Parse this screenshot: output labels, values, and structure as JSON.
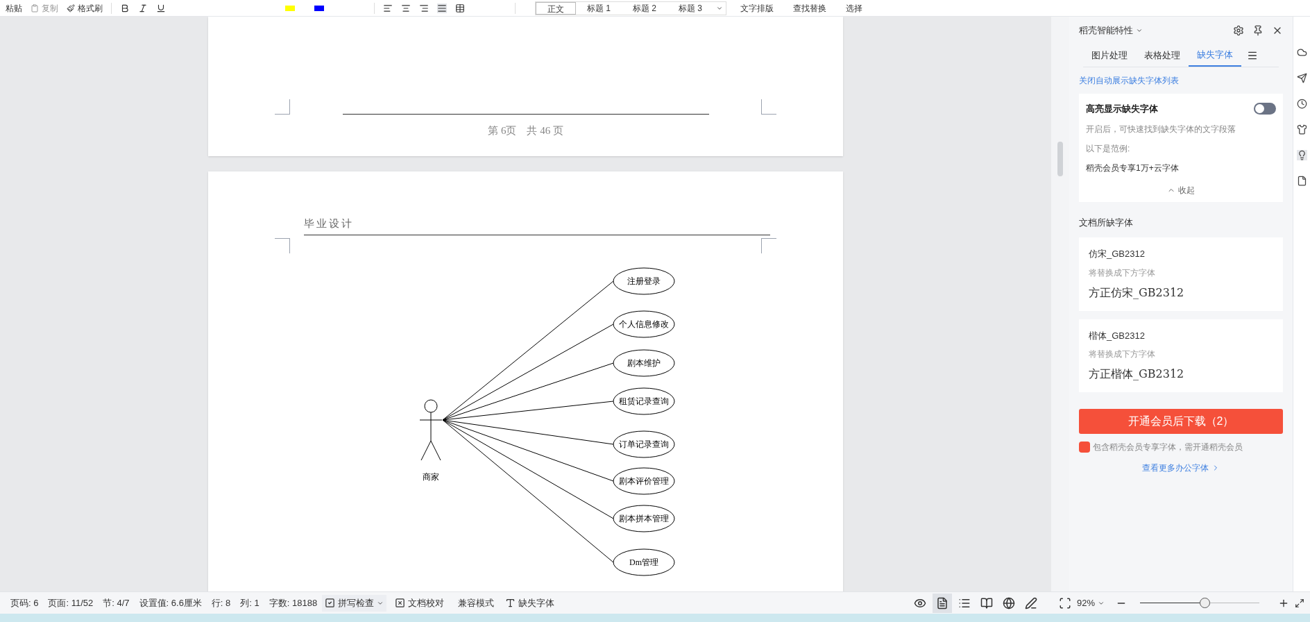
{
  "toolbar": {
    "clipboard": [
      "粘贴",
      "复制",
      "格式刷"
    ],
    "styles": [
      {
        "label": "正文",
        "selected": true
      },
      {
        "label": "标题 1",
        "selected": false
      },
      {
        "label": "标题 2",
        "selected": false
      },
      {
        "label": "标题 3",
        "selected": false
      }
    ],
    "tools": [
      "文字排版",
      "查找替换",
      "选择"
    ]
  },
  "document": {
    "previous_page_footer": "第 6页　共 46 页",
    "header": "毕业设计",
    "diagram": {
      "actor": "商家",
      "use_cases": [
        "注册登录",
        "个人信息修改",
        "剧本维护",
        "租赁记录查询",
        "订单记录查询",
        "剧本评价管理",
        "剧本拼本管理",
        "Dm管理"
      ]
    }
  },
  "panel": {
    "title": "稻壳智能特性",
    "tabs": [
      {
        "label": "图片处理",
        "selected": false
      },
      {
        "label": "表格处理",
        "selected": false
      },
      {
        "label": "缺失字体",
        "selected": true
      }
    ],
    "link": "关闭自动展示缺失字体列表",
    "highlight": {
      "title": "高亮显示缺失字体",
      "on": false,
      "description": "开启后，可快速找到缺失字体的文字段落",
      "example_label": "以下是范例:",
      "example": "稻壳会员专享1万+云字体",
      "collapse": "收起"
    },
    "section_title": "文档所缺字体",
    "fonts": [
      {
        "name": "仿宋_GB2312",
        "hint": "将替换成下方字体",
        "replacement": "方正仿宋_GB2312"
      },
      {
        "name": "楷体_GB2312",
        "hint": "将替换成下方字体",
        "replacement": "方正楷体_GB2312"
      }
    ],
    "button": "开通会员后下载（2）",
    "note": "包含稻壳会员专享字体，需开通稻壳会员",
    "more_link": "查看更多办公字体"
  },
  "status_bar": {
    "items": [
      "页码: 6",
      "页面: 11/52",
      "节: 4/7",
      "设置值: 6.6厘米",
      "行: 8",
      "列: 1",
      "字数: 18188"
    ],
    "spell_check": "拼写检查",
    "proofread": "文档校对",
    "compat": "兼容模式",
    "missing_fonts": "缺失字体",
    "views": [
      {
        "kind": "eye",
        "selected": false
      },
      {
        "kind": "page",
        "selected": true
      },
      {
        "kind": "outline",
        "selected": false
      },
      {
        "kind": "book",
        "selected": false
      },
      {
        "kind": "web",
        "selected": false
      },
      {
        "kind": "pen",
        "selected": false
      }
    ],
    "zoom": "92%",
    "zoom_level": {
      "level": 0.54
    }
  }
}
